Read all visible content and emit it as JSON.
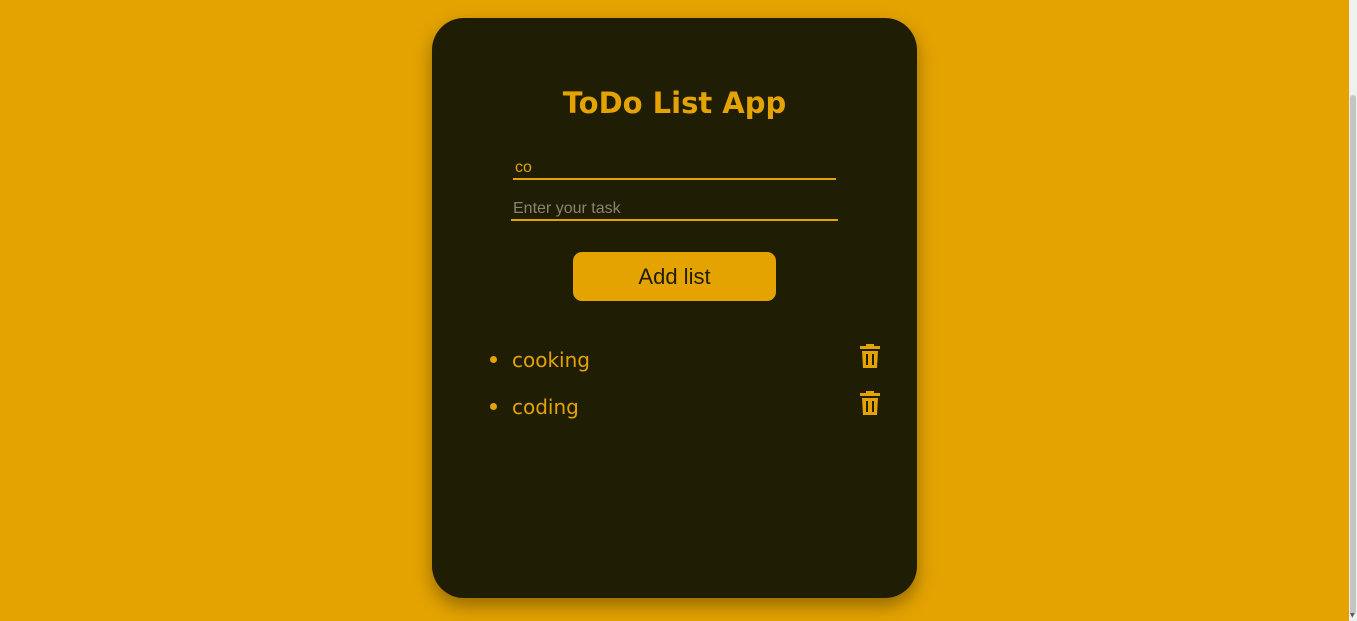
{
  "app": {
    "title": "ToDo List App"
  },
  "form": {
    "first_input_value": "co",
    "task_input_value": "",
    "task_input_placeholder": "Enter your task",
    "add_button_label": "Add list"
  },
  "todos": [
    {
      "text": "cooking",
      "action_icon": "trash-icon"
    },
    {
      "text": "coding",
      "action_icon": "trash-icon"
    }
  ],
  "colors": {
    "background": "#e4a300",
    "card": "#1f1d03",
    "accent": "#e4a300"
  }
}
